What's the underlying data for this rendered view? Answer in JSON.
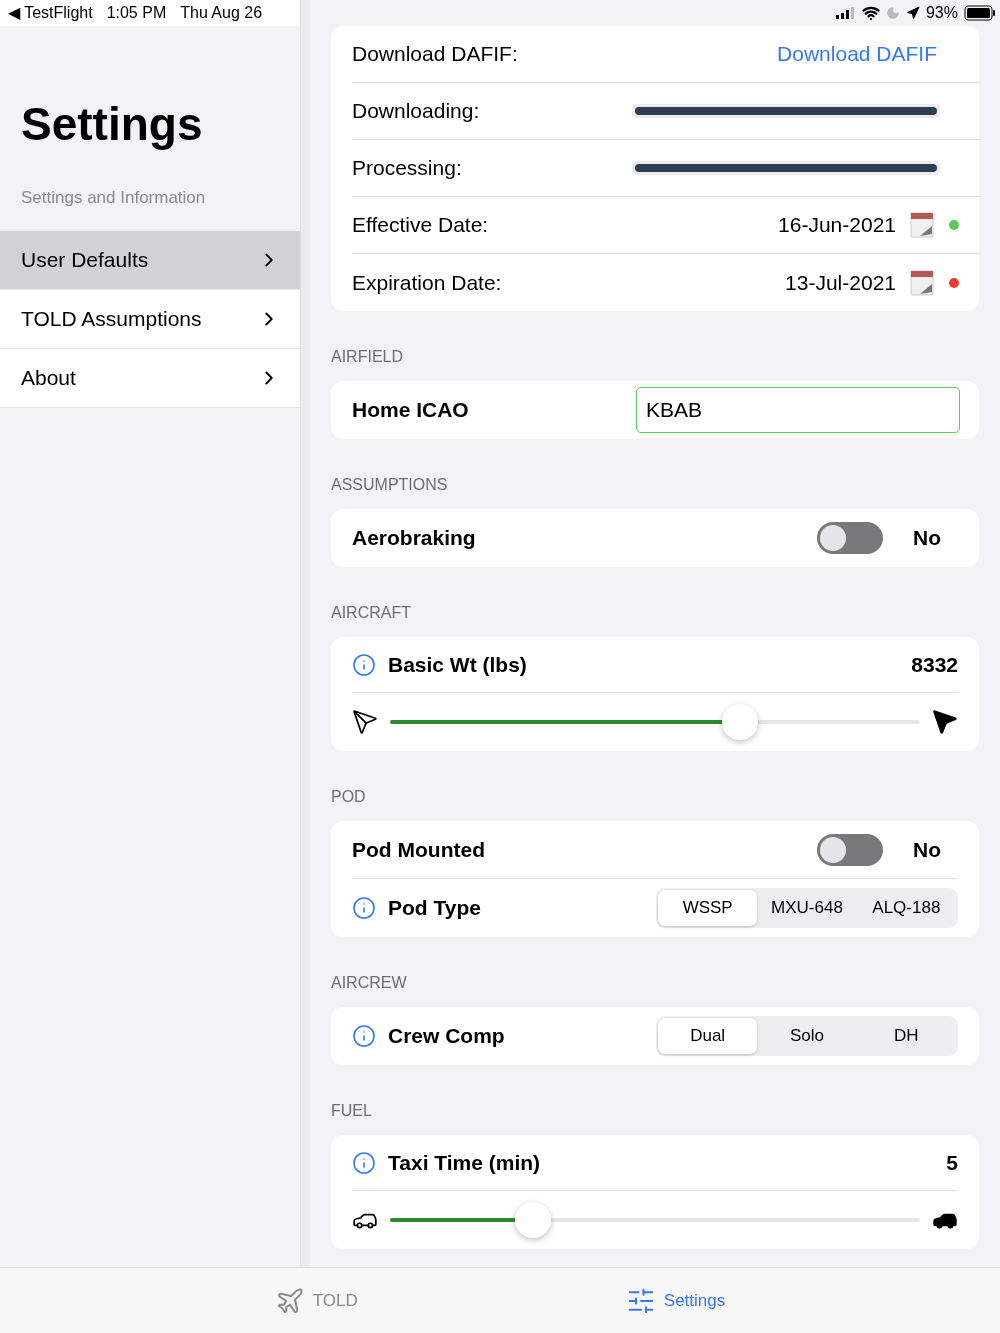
{
  "status_bar": {
    "back": "◀ TestFlight",
    "time": "1:05 PM",
    "date": "Thu Aug 26",
    "battery": "93%"
  },
  "sidebar": {
    "title": "Settings",
    "subtitle": "Settings and Information",
    "items": [
      {
        "label": "User Defaults",
        "selected": true
      },
      {
        "label": "TOLD Assumptions",
        "selected": false
      },
      {
        "label": "About",
        "selected": false
      }
    ]
  },
  "dafif": {
    "rows": [
      {
        "kind": "link",
        "label": "Download DAFIF:",
        "value": "Download DAFIF"
      },
      {
        "kind": "progress",
        "label": "Downloading:",
        "level": 1
      },
      {
        "kind": "progress",
        "label": "Processing:",
        "level": 1
      },
      {
        "kind": "date",
        "label": "Effective Date:",
        "value": "16-Jun-2021",
        "color": "#5ac85a"
      },
      {
        "kind": "date",
        "label": "Expiration Date:",
        "value": "13-Jul-2021",
        "color": "#eb3b2a"
      }
    ]
  },
  "sections": [
    {
      "header": "AIRFIELD",
      "rows": [
        {
          "kind": "field",
          "label": "Home ICAO",
          "value": "KBAB"
        }
      ]
    },
    {
      "header": "ASSUMPTIONS",
      "rows": [
        {
          "kind": "toggle",
          "label": "Aerobraking",
          "on": false,
          "value": "No"
        }
      ]
    },
    {
      "header": "AIRCRAFT",
      "rows": [
        {
          "kind": "slider",
          "label": "Basic Wt (lbs)",
          "value": "8332",
          "level": 0.66
        }
      ]
    },
    {
      "header": "POD",
      "rows": [
        {
          "kind": "toggle",
          "label": "Pod Mounted",
          "on": false,
          "value": "No"
        },
        {
          "kind": "segments",
          "label": "Pod Type",
          "options": [
            {
              "label": "WSSP",
              "selected": true
            },
            {
              "label": "MXU-648",
              "selected": false
            },
            {
              "label": "ALQ-188",
              "selected": false
            }
          ]
        }
      ]
    },
    {
      "header": "AIRCREW",
      "rows": [
        {
          "kind": "segments",
          "label": "Crew Comp",
          "options": [
            {
              "label": "Dual",
              "selected": true
            },
            {
              "label": "Solo",
              "selected": false
            },
            {
              "label": "DH",
              "selected": false
            }
          ]
        }
      ]
    },
    {
      "header": "FUEL",
      "rows": [
        {
          "kind": "slider",
          "label": "Taxi Time (min)",
          "value": "5",
          "level": 0.27
        }
      ]
    }
  ],
  "tab_bar": [
    {
      "label": "TOLD",
      "selected": false
    },
    {
      "label": "Settings",
      "selected": true
    }
  ]
}
